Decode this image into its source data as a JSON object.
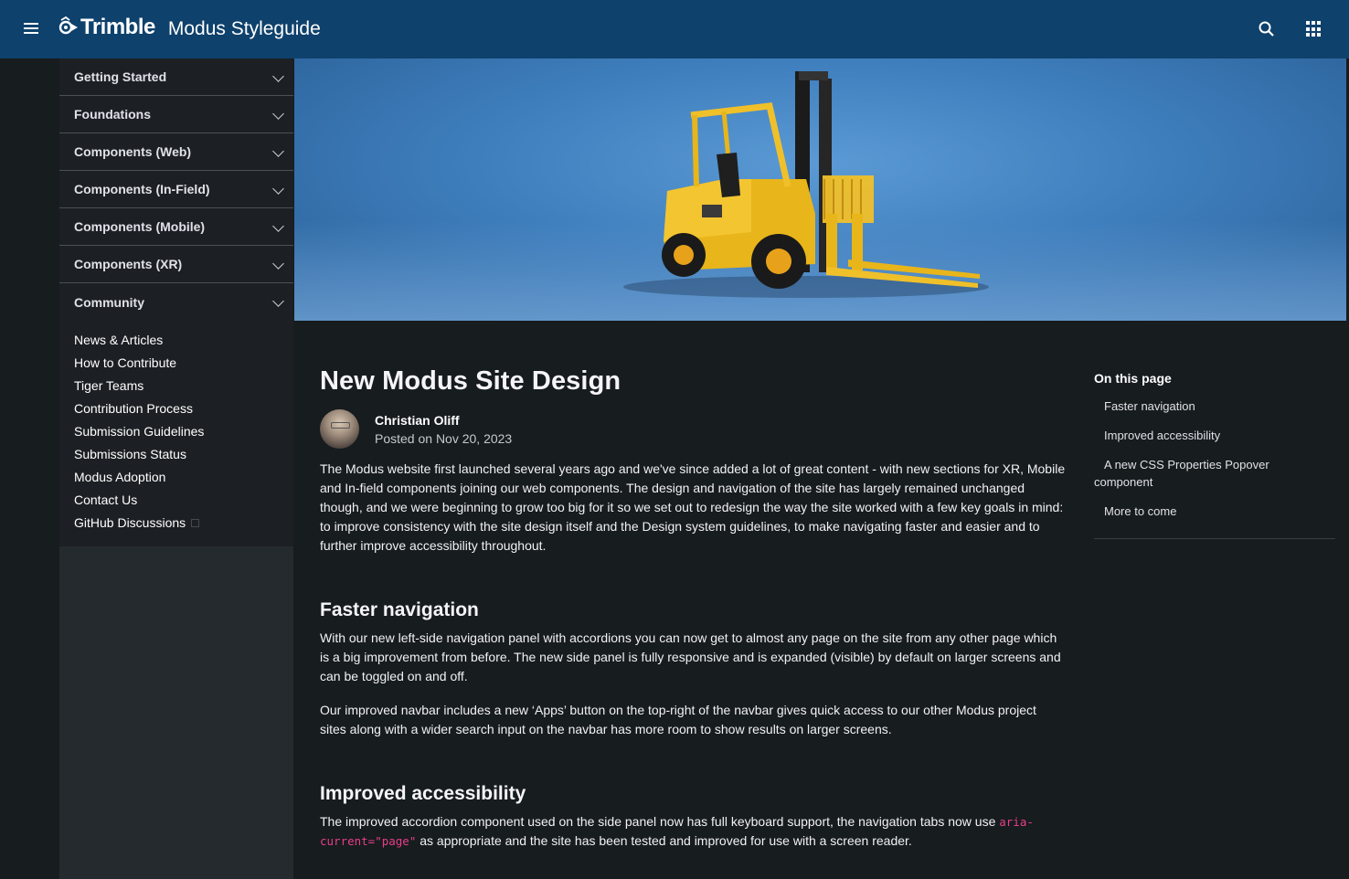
{
  "navbar": {
    "brand_name": "Trimble",
    "product_name": "Modus Styleguide"
  },
  "sidebar": {
    "sections": [
      {
        "label": "Getting Started"
      },
      {
        "label": "Foundations"
      },
      {
        "label": "Components (Web)"
      },
      {
        "label": "Components (In-Field)"
      },
      {
        "label": "Components (Mobile)"
      },
      {
        "label": "Components (XR)"
      },
      {
        "label": "Community"
      }
    ],
    "community_items": [
      {
        "label": "News & Articles"
      },
      {
        "label": "How to Contribute"
      },
      {
        "label": "Tiger Teams"
      },
      {
        "label": "Contribution Process"
      },
      {
        "label": "Submission Guidelines"
      },
      {
        "label": "Submissions Status"
      },
      {
        "label": "Modus Adoption"
      },
      {
        "label": "Contact Us"
      },
      {
        "label": "GitHub Discussions"
      }
    ]
  },
  "article": {
    "title": "New Modus Site Design",
    "author_name": "Christian Oliff",
    "posted": "Posted on Nov 20, 2023",
    "intro": "The Modus website first launched several years ago and we've since added a lot of great content - with new sections for XR, Mobile and In-field components joining our web components. The design and navigation of the site has largely remained unchanged though, and we were beginning to grow too big for it so we set out to redesign the way the site worked with a few key goals in mind: to improve consistency with the site design itself and the Design system guidelines, to make navigating faster and easier and to further improve accessibility throughout.",
    "faster_heading": "Faster navigation",
    "faster_p1": "With our new left-side navigation panel with accordions you can now get to almost any page on the site from any other page which is a big improvement from before. The new side panel is fully responsive and is expanded (visible) by default on larger screens and can be toggled on and off.",
    "faster_p2": "Our improved navbar includes a new ‘Apps’ button on the top-right of the navbar gives quick access to our other Modus project sites along with a wider search input on the navbar has more room to show results on larger screens.",
    "access_heading": "Improved accessibility",
    "access_p1_before": "The improved accordion component used on the side panel now has full keyboard support, the navigation tabs now use ",
    "access_code": "aria-current=\"page\"",
    "access_p1_after": " as appropriate and the site has been tested and improved for use with a screen reader."
  },
  "toc": {
    "title": "On this page",
    "items": [
      {
        "label": "Faster navigation"
      },
      {
        "label": "Improved accessibility"
      },
      {
        "label": "A new CSS Properties Popover component"
      },
      {
        "label": "More to come"
      }
    ]
  },
  "colors": {
    "navbar": "#0e416c",
    "sidebar": "#1c2024",
    "background": "#171c1e",
    "code": "#e83e8c"
  }
}
